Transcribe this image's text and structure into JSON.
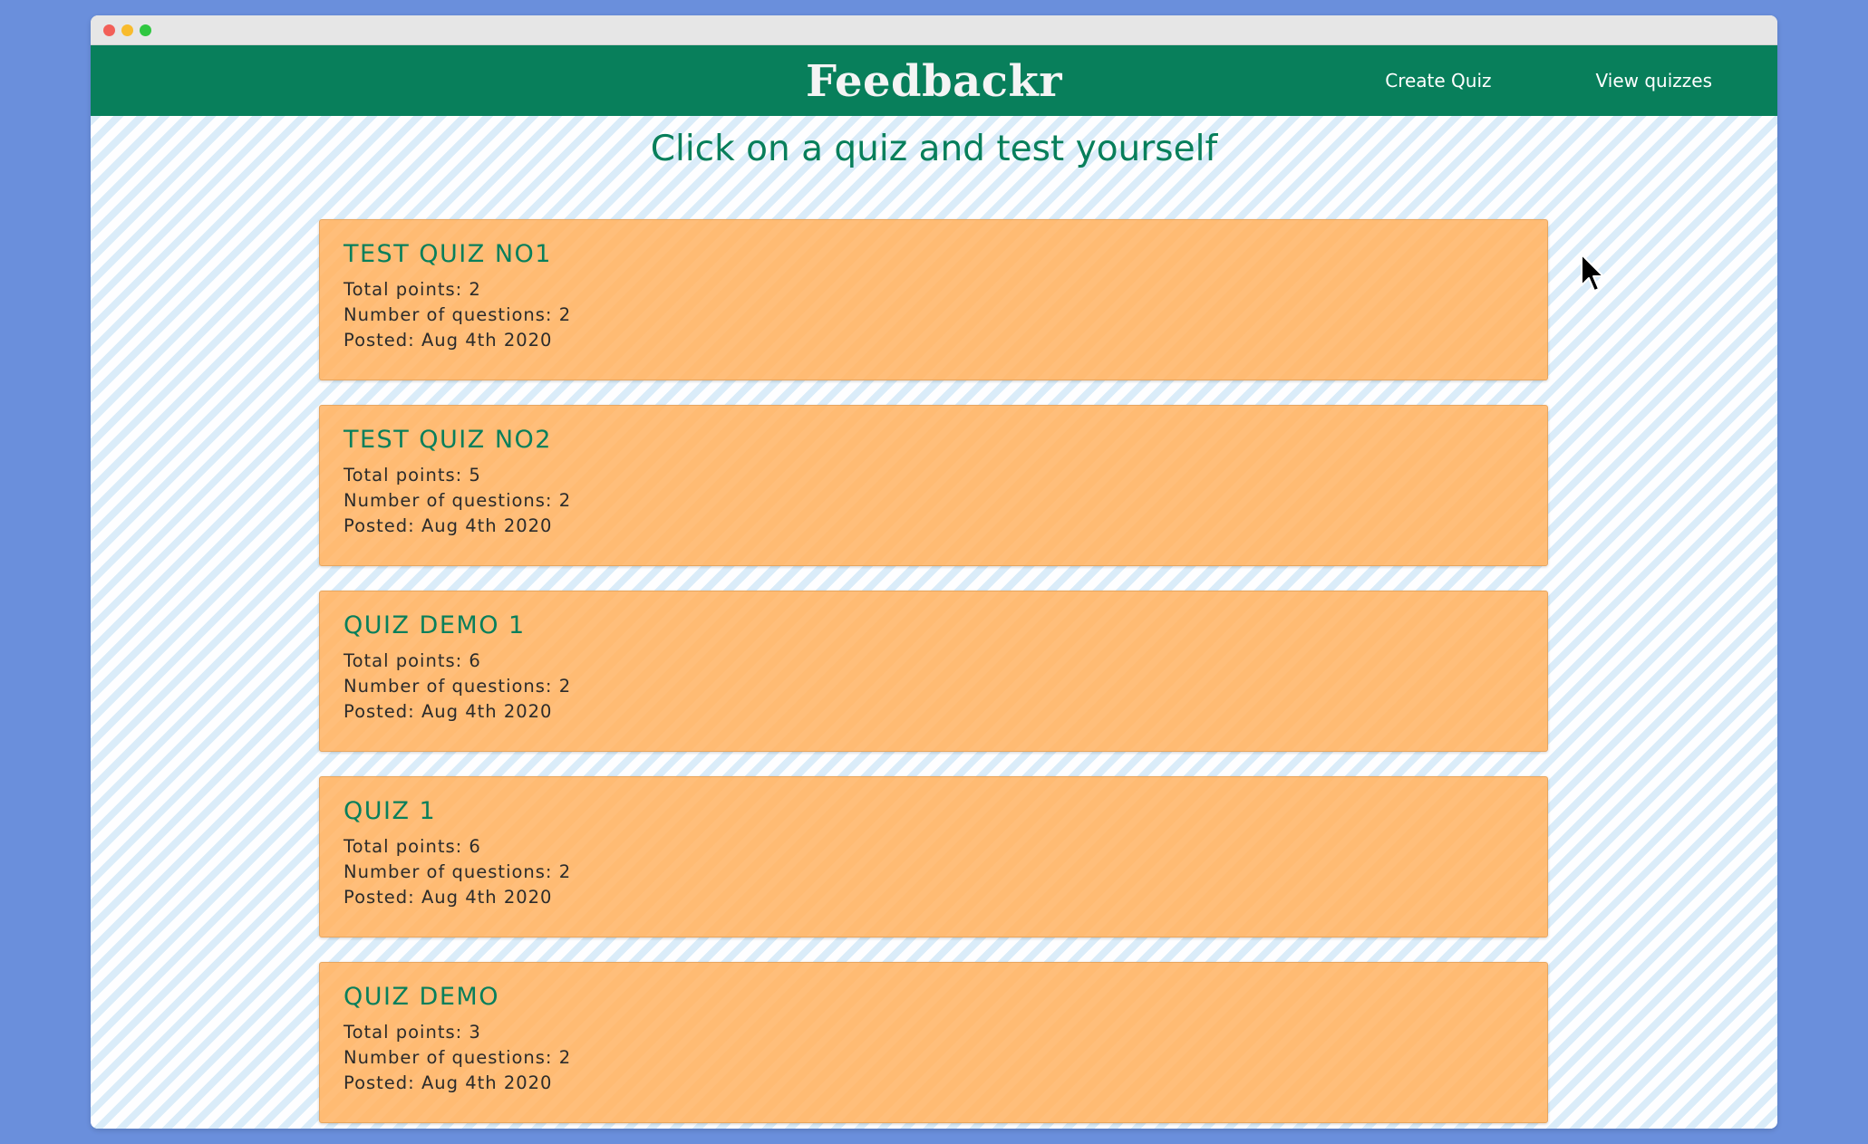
{
  "app": {
    "brand": "Feedbackr"
  },
  "nav": {
    "create_quiz": "Create Quiz",
    "view_quizzes": "View quizzes"
  },
  "main": {
    "heading": "Click on a quiz and test yourself"
  },
  "quizzes": [
    {
      "title": "TEST QUIZ NO1",
      "total_points": "Total points: 2",
      "num_questions": "Number of questions: 2",
      "posted": "Posted: Aug 4th 2020"
    },
    {
      "title": "TEST QUIZ NO2",
      "total_points": "Total points: 5",
      "num_questions": "Number of questions: 2",
      "posted": "Posted: Aug 4th 2020"
    },
    {
      "title": "QUIZ DEMO 1",
      "total_points": "Total points: 6",
      "num_questions": "Number of questions: 2",
      "posted": "Posted: Aug 4th 2020"
    },
    {
      "title": "QUIZ 1",
      "total_points": "Total points: 6",
      "num_questions": "Number of questions: 2",
      "posted": "Posted: Aug 4th 2020"
    },
    {
      "title": "QUIZ DEMO",
      "total_points": "Total points: 3",
      "num_questions": "Number of questions: 2",
      "posted": "Posted: Aug 4th 2020"
    }
  ],
  "colors": {
    "primary": "#087f5b",
    "card": "#ffbb73",
    "backdrop": "#6a8fdc"
  },
  "icons": {
    "cursor": "mouse-pointer-icon"
  }
}
